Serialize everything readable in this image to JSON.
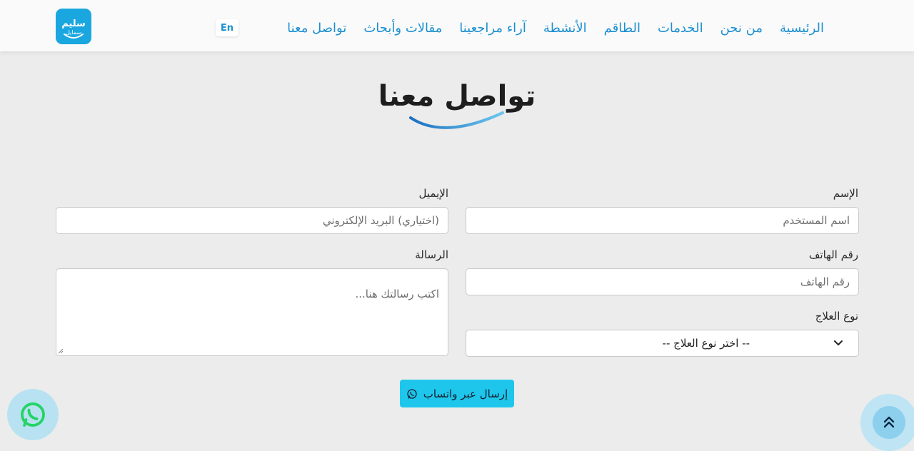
{
  "logo": {
    "line1": "سليم",
    "line2": "سمايل"
  },
  "nav": {
    "items": [
      "الرئيسية",
      "من نحن",
      "الخدمات",
      "الطاقم",
      "الأنشطة",
      "آراء مراجعينا",
      "مقالات وأبحاث",
      "تواصل معنا"
    ],
    "lang_toggle": "En"
  },
  "page": {
    "title": "تواصل معنا"
  },
  "form": {
    "name_label": "الإسم",
    "name_placeholder": "اسم المستخدم",
    "email_label": "الإيميل",
    "email_placeholder": "(اختياري) البريد الإلكتروني",
    "phone_label": "رقم الهاتف",
    "phone_placeholder": "رقم الهاتف",
    "message_label": "الرسالة",
    "message_placeholder": "اكتب رسالتك هنا...",
    "treatment_label": "نوع العلاج",
    "treatment_selected": "-- اختر نوع العلاج --",
    "submit_label": "إرسال عبر واتساب"
  },
  "colors": {
    "accent": "#1b8fd1",
    "logo_bg": "#1aa7e0",
    "button": "#1ec6ec",
    "whatsapp": "#25d366"
  },
  "icons": {
    "whatsapp": "whatsapp-icon",
    "scroll_top": "double-chevron-up-icon",
    "select": "chevron-down-icon"
  }
}
